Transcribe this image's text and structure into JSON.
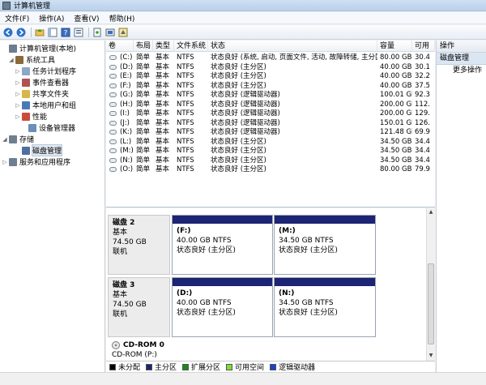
{
  "window": {
    "title": "计算机管理"
  },
  "menu": [
    "文件(F)",
    "操作(A)",
    "查看(V)",
    "帮助(H)"
  ],
  "toolbar": [
    "back-icon",
    "forward-icon",
    "up-folder-icon",
    "show-tree-icon",
    "help-icon",
    "properties-icon",
    "export-icon",
    "refresh-icon",
    "settings-icon"
  ],
  "tree": {
    "root": "计算机管理(本地)",
    "items": [
      {
        "label": "系统工具",
        "expander": "◢",
        "icon": "tools-icon"
      },
      {
        "label": "任务计划程序",
        "expander": "▷",
        "icon": "task-scheduler-icon"
      },
      {
        "label": "事件查看器",
        "expander": "▷",
        "icon": "event-viewer-icon"
      },
      {
        "label": "共享文件夹",
        "expander": "▷",
        "icon": "shared-folders-icon"
      },
      {
        "label": "本地用户和组",
        "expander": "▷",
        "icon": "users-icon"
      },
      {
        "label": "性能",
        "expander": "▷",
        "icon": "performance-icon"
      },
      {
        "label": "设备管理器",
        "expander": "",
        "icon": "device-manager-icon"
      },
      {
        "label": "存储",
        "expander": "◢",
        "icon": "storage-icon"
      },
      {
        "label": "磁盘管理",
        "expander": "",
        "icon": "disk-management-icon"
      },
      {
        "label": "服务和应用程序",
        "expander": "▷",
        "icon": "services-icon"
      }
    ]
  },
  "volumes": {
    "columns": [
      "卷",
      "布局",
      "类型",
      "文件系统",
      "状态",
      "容量",
      "可用"
    ],
    "rows": [
      [
        "(C:)",
        "简单",
        "基本",
        "NTFS",
        "状态良好 (系统, 启动, 页面文件, 活动, 故障转储, 主分区)",
        "80.00 GB",
        "30.4"
      ],
      [
        "(D:)",
        "简单",
        "基本",
        "NTFS",
        "状态良好 (主分区)",
        "40.00 GB",
        "30.1"
      ],
      [
        "(E:)",
        "简单",
        "基本",
        "NTFS",
        "状态良好 (主分区)",
        "40.00 GB",
        "32.2"
      ],
      [
        "(F:)",
        "简单",
        "基本",
        "NTFS",
        "状态良好 (主分区)",
        "40.00 GB",
        "37.5"
      ],
      [
        "(G:)",
        "简单",
        "基本",
        "NTFS",
        "状态良好 (逻辑驱动器)",
        "100.01 GB",
        "92.3"
      ],
      [
        "(H:)",
        "简单",
        "基本",
        "NTFS",
        "状态良好 (逻辑驱动器)",
        "200.00 GB",
        "112."
      ],
      [
        "(I:)",
        "简单",
        "基本",
        "NTFS",
        "状态良好 (逻辑驱动器)",
        "200.00 GB",
        "129."
      ],
      [
        "(J:)",
        "简单",
        "基本",
        "NTFS",
        "状态良好 (逻辑驱动器)",
        "150.01 GB",
        "126."
      ],
      [
        "(K:)",
        "简单",
        "基本",
        "NTFS",
        "状态良好 (逻辑驱动器)",
        "121.48 GB",
        "69.9"
      ],
      [
        "(L:)",
        "简单",
        "基本",
        "NTFS",
        "状态良好 (主分区)",
        "34.50 GB",
        "34.4"
      ],
      [
        "(M:)",
        "简单",
        "基本",
        "NTFS",
        "状态良好 (主分区)",
        "34.50 GB",
        "34.4"
      ],
      [
        "(N:)",
        "简单",
        "基本",
        "NTFS",
        "状态良好 (主分区)",
        "34.50 GB",
        "34.4"
      ],
      [
        "(O:)",
        "简单",
        "基本",
        "NTFS",
        "状态良好 (主分区)",
        "80.00 GB",
        "79.9"
      ]
    ],
    "scroll_grip": "|||"
  },
  "disks": [
    {
      "name": "磁盘 2",
      "type": "基本",
      "size": "74.50 GB",
      "status": "联机",
      "partitions": [
        {
          "letter": "(F:)",
          "size": "40.00 GB NTFS",
          "status": "状态良好 (主分区)"
        },
        {
          "letter": "(M:)",
          "size": "34.50 GB NTFS",
          "status": "状态良好 (主分区)"
        }
      ]
    },
    {
      "name": "磁盘 3",
      "type": "基本",
      "size": "74.50 GB",
      "status": "联机",
      "partitions": [
        {
          "letter": "(D:)",
          "size": "40.00 GB NTFS",
          "status": "状态良好 (主分区)"
        },
        {
          "letter": "(N:)",
          "size": "34.50 GB NTFS",
          "status": "状态良好 (主分区)"
        }
      ]
    }
  ],
  "cdrom": {
    "name": "CD-ROM 0",
    "drive": "CD-ROM (P:)"
  },
  "legend": [
    {
      "label": "未分配",
      "color": "#000000"
    },
    {
      "label": "主分区",
      "color": "#1c2473"
    },
    {
      "label": "扩展分区",
      "color": "#1a8a1a"
    },
    {
      "label": "可用空间",
      "color": "#7ddc3a"
    },
    {
      "label": "逻辑驱动器",
      "color": "#1a3fd6"
    }
  ],
  "actions": {
    "header": "操作",
    "section": "磁盘管理",
    "more": "更多操作"
  }
}
